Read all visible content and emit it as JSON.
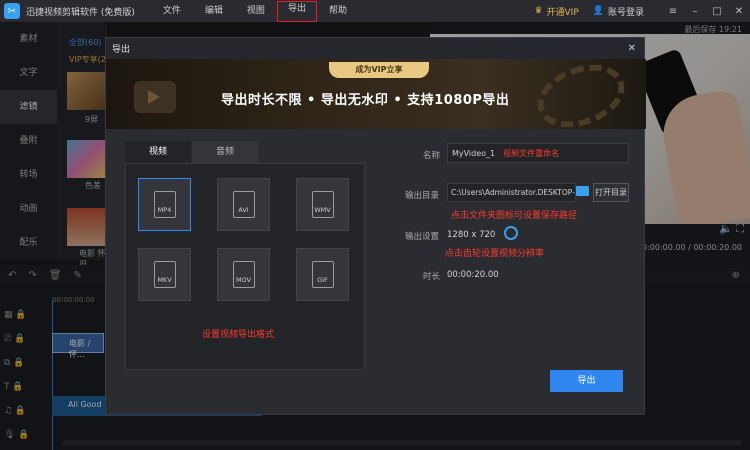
{
  "app": {
    "title": "迅捷视频剪辑软件 (免费版)",
    "menu": [
      "文件",
      "编辑",
      "视图",
      "导出",
      "帮助"
    ],
    "vip": "开通VIP",
    "account": "账号登录",
    "last_saved": "最后保存 19:21"
  },
  "leftnav": [
    "素材",
    "文字",
    "滤镜",
    "叠附",
    "转场",
    "动画",
    "配乐"
  ],
  "media": {
    "tab_all": "全部(60)",
    "tab_vip": "VIP专享(2",
    "items": [
      "9屏",
      "色差",
      "电影 怀旧"
    ]
  },
  "preview": {
    "time": "00:00:00.00 / 00:00:20.00"
  },
  "timeline": {
    "ruler_start": "00:00:00.00",
    "video_clip": "电影 / 怀...",
    "audio_clip": "All Good"
  },
  "dialog": {
    "title": "导出",
    "banner_badge": "成为VIP立享",
    "banner_text": "导出时长不限 • 导出无水印 • 支持1080P导出",
    "tabs": [
      "视频",
      "音频"
    ],
    "formats": [
      "MP4",
      "AVI",
      "WMV",
      "MKV",
      "MOV",
      "GIF"
    ],
    "format_hint": "设置视频导出格式",
    "name_label": "名称",
    "name_value": "MyVideo_1",
    "name_annotation": "视频文件重命名",
    "dir_label": "输出目录",
    "dir_value": "C:\\Users\\Administrator.DESKTOP-",
    "open_dir": "打开目录",
    "dir_annotation": "点击文件夹图标可设置保存路径",
    "settings_label": "输出设置",
    "settings_value": "1280 x 720",
    "settings_annotation": "点击齿轮设置视频分辨率",
    "duration_label": "时长",
    "duration_value": "00:00:20.00",
    "export_button": "导出"
  }
}
